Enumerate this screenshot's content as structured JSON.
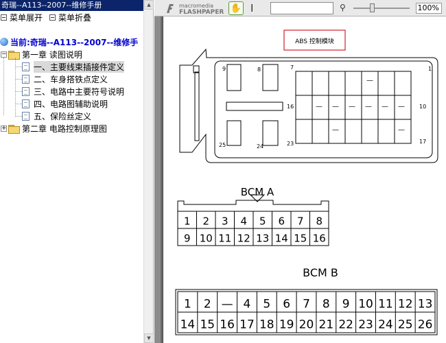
{
  "window": {
    "title": "奇瑞--A113--2007--维修手册"
  },
  "toolbar": {
    "expand_label": "菜单展开",
    "collapse_label": "菜单折叠"
  },
  "tree": {
    "current_label": "当前:奇瑞--A113--2007--维修手",
    "chapters": [
      {
        "label": "第一章  读图说明",
        "expanded": true,
        "expander": "−",
        "items": [
          {
            "label": "一、主要线束插接件定义",
            "selected": true
          },
          {
            "label": "二、车身搭铁点定义",
            "selected": false
          },
          {
            "label": "三、电路中主要符号说明",
            "selected": false
          },
          {
            "label": "四、电路图辅助说明",
            "selected": false
          },
          {
            "label": "五、保险丝定义",
            "selected": false
          }
        ]
      },
      {
        "label": "第二章  电路控制原理图",
        "expanded": false,
        "expander": "+"
      }
    ]
  },
  "viewer": {
    "brand_top": "macromedia",
    "brand_bottom": "FLASHPAPER",
    "search_value": "",
    "zoom": "100%",
    "slider_level": 0.34
  },
  "document": {
    "abs_label": "ABS 控制模块",
    "abs_pins": {
      "p9": "9",
      "p8": "8",
      "p7": "7",
      "p1": "1",
      "p16": "16",
      "p10": "10",
      "p25": "25",
      "p24": "24",
      "p23": "23",
      "p17": "17",
      "dash": "—"
    },
    "bcm_a": {
      "title": "BCM  A",
      "row1": [
        "1",
        "2",
        "3",
        "4",
        "5",
        "6",
        "7",
        "8"
      ],
      "row2": [
        "9",
        "10",
        "11",
        "12",
        "13",
        "14",
        "15",
        "16"
      ]
    },
    "bcm_b": {
      "title": "BCM  B",
      "row1": [
        "1",
        "2",
        "—",
        "4",
        "5",
        "6",
        "7",
        "8",
        "9",
        "10",
        "11",
        "12",
        "13"
      ],
      "row2": [
        "14",
        "15",
        "16",
        "17",
        "18",
        "19",
        "20",
        "21",
        "22",
        "23",
        "24",
        "25",
        "26"
      ]
    }
  },
  "colors": {
    "title_bar": "#0b246a",
    "current_text": "#0000d0",
    "abs_box": "#d0202a",
    "viewer_bg": "#8c8c8c",
    "hand_tool_border": "#5a9a3a"
  },
  "icons": [
    "folder-icon",
    "document-icon",
    "globe-icon",
    "hand-tool-icon",
    "text-select-icon",
    "search-icon",
    "scroll-up-arrow-icon",
    "scroll-down-arrow-icon"
  ]
}
